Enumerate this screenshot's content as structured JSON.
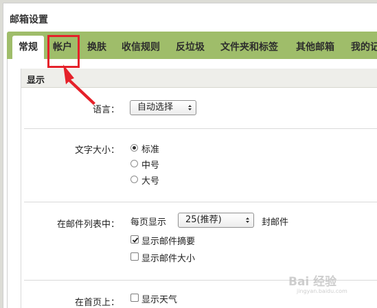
{
  "window": {
    "title": "邮箱设置"
  },
  "tabs": [
    {
      "label": "常规",
      "active": true
    },
    {
      "label": "帐户",
      "active": false,
      "highlighted": true
    },
    {
      "label": "换肤",
      "active": false
    },
    {
      "label": "收信规则",
      "active": false
    },
    {
      "label": "反垃圾",
      "active": false
    },
    {
      "label": "文件夹和标签",
      "active": false
    },
    {
      "label": "其他邮箱",
      "active": false
    },
    {
      "label": "我的记",
      "active": false
    }
  ],
  "section": {
    "title": "显示"
  },
  "language": {
    "label": "语言：",
    "selected": "自动选择"
  },
  "font_size": {
    "label": "文字大小：",
    "options": [
      {
        "label": "标准",
        "checked": true
      },
      {
        "label": "中号",
        "checked": false
      },
      {
        "label": "大号",
        "checked": false
      }
    ]
  },
  "mail_list": {
    "label": "在邮件列表中：",
    "per_page_prefix": "每页显示",
    "per_page_selected": "25(推荐)",
    "per_page_suffix": "封邮件",
    "options": [
      {
        "label": "显示邮件摘要",
        "checked": true
      },
      {
        "label": "显示邮件大小",
        "checked": false
      }
    ]
  },
  "homepage": {
    "label": "在首页上：",
    "options": [
      {
        "label": "显示天气",
        "checked": false
      }
    ]
  },
  "watermark": {
    "text": "Bai 经验",
    "sub": "jingyan.baidu.com"
  },
  "colors": {
    "tabbar": "#9fbd6a",
    "highlight": "#e5212a"
  }
}
